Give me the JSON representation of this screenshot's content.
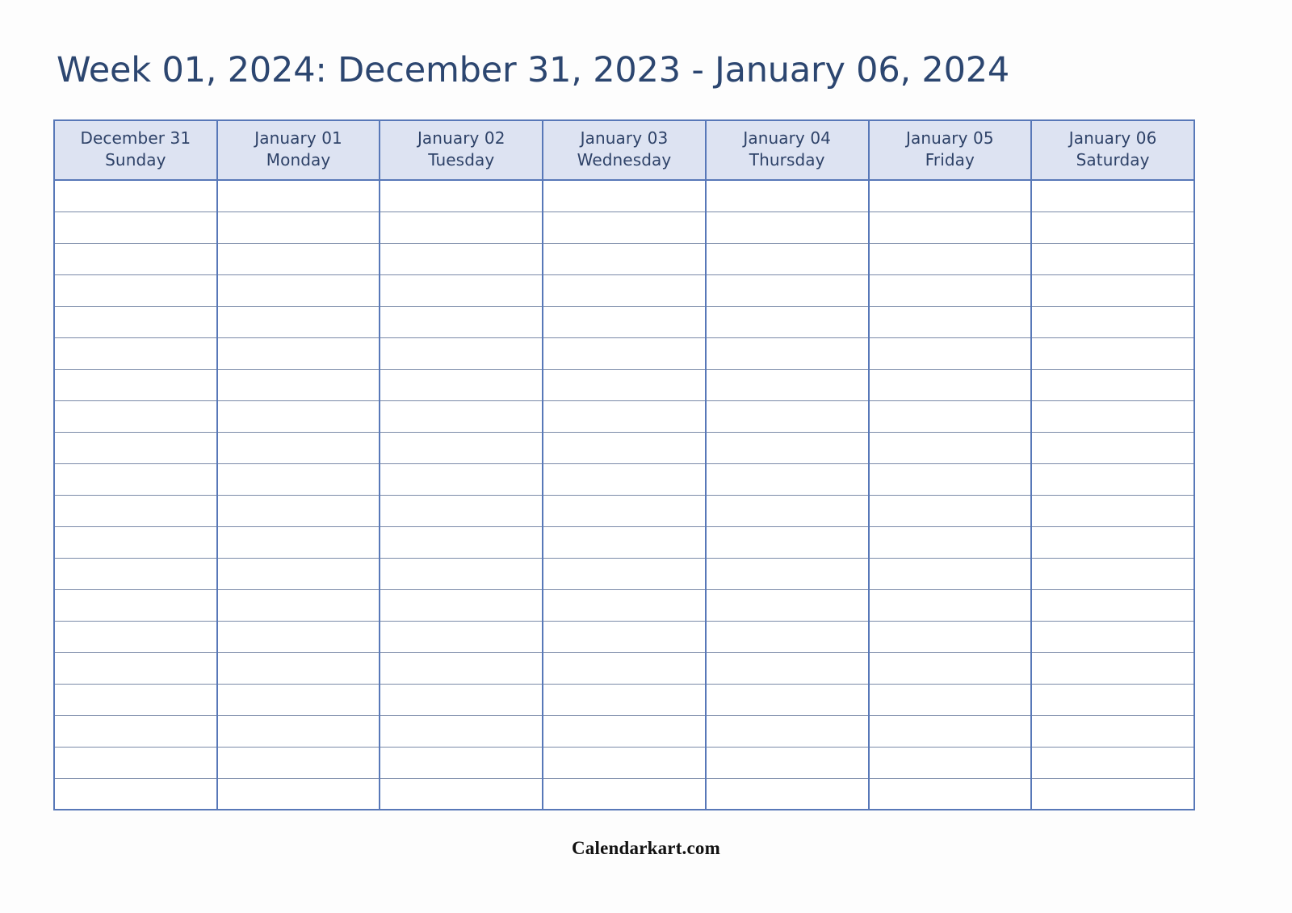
{
  "page": {
    "title": "Week 01, 2024: December 31, 2023 - January 06, 2024",
    "footer": "Calendarkart.com"
  },
  "theme": {
    "title_color": "#2c4670",
    "header_bg": "#dde3f2",
    "header_text_color": "#2e4268",
    "vertical_border_color": "#5878b8",
    "horizontal_border_color": "#7a8aa8",
    "cell_bg": "#ffffff",
    "page_bg": "#ffffff"
  },
  "calendar": {
    "week_number": "01",
    "year": "2024",
    "range_start": "December 31, 2023",
    "range_end": "January 06, 2024",
    "row_count": 20,
    "columns": [
      {
        "date": "December 31",
        "day": "Sunday"
      },
      {
        "date": "January 01",
        "day": "Monday"
      },
      {
        "date": "January 02",
        "day": "Tuesday"
      },
      {
        "date": "January 03",
        "day": "Wednesday"
      },
      {
        "date": "January 04",
        "day": "Thursday"
      },
      {
        "date": "January 05",
        "day": "Friday"
      },
      {
        "date": "January 06",
        "day": "Saturday"
      }
    ],
    "rows": [
      [
        "",
        "",
        "",
        "",
        "",
        "",
        ""
      ],
      [
        "",
        "",
        "",
        "",
        "",
        "",
        ""
      ],
      [
        "",
        "",
        "",
        "",
        "",
        "",
        ""
      ],
      [
        "",
        "",
        "",
        "",
        "",
        "",
        ""
      ],
      [
        "",
        "",
        "",
        "",
        "",
        "",
        ""
      ],
      [
        "",
        "",
        "",
        "",
        "",
        "",
        ""
      ],
      [
        "",
        "",
        "",
        "",
        "",
        "",
        ""
      ],
      [
        "",
        "",
        "",
        "",
        "",
        "",
        ""
      ],
      [
        "",
        "",
        "",
        "",
        "",
        "",
        ""
      ],
      [
        "",
        "",
        "",
        "",
        "",
        "",
        ""
      ],
      [
        "",
        "",
        "",
        "",
        "",
        "",
        ""
      ],
      [
        "",
        "",
        "",
        "",
        "",
        "",
        ""
      ],
      [
        "",
        "",
        "",
        "",
        "",
        "",
        ""
      ],
      [
        "",
        "",
        "",
        "",
        "",
        "",
        ""
      ],
      [
        "",
        "",
        "",
        "",
        "",
        "",
        ""
      ],
      [
        "",
        "",
        "",
        "",
        "",
        "",
        ""
      ],
      [
        "",
        "",
        "",
        "",
        "",
        "",
        ""
      ],
      [
        "",
        "",
        "",
        "",
        "",
        "",
        ""
      ],
      [
        "",
        "",
        "",
        "",
        "",
        "",
        ""
      ],
      [
        "",
        "",
        "",
        "",
        "",
        "",
        ""
      ]
    ]
  }
}
